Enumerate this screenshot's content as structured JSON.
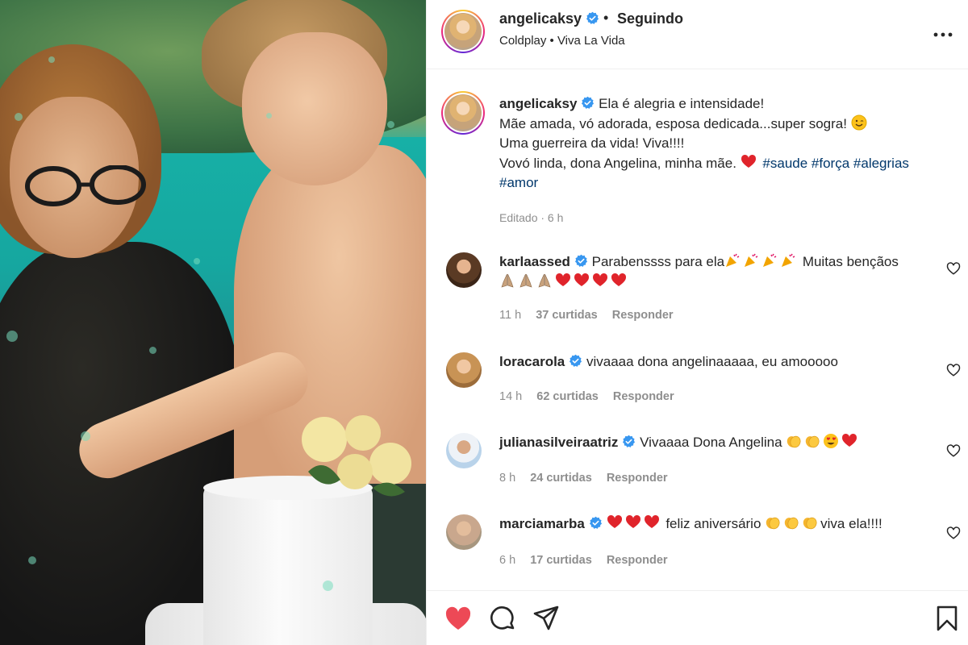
{
  "post": {
    "username": "angelicaksy",
    "following_label": "Seguindo",
    "separator": "•",
    "music": "Coldplay • Viva La Vida"
  },
  "caption": {
    "username": "angelicaksy",
    "line1": "Ela é alegria e intensidade!",
    "line2": "Mãe amada, vó adorada, esposa dedicada...super sogra!",
    "line3": "Uma guerreira da vida! Viva!!!!",
    "line4": "Vovó linda, dona Angelina, minha mãe.",
    "tags": [
      "#saude",
      "#força",
      "#alegrias",
      "#amor"
    ],
    "edited": "Editado · 6 h"
  },
  "comments": [
    {
      "username": "karlaassed",
      "text_a": "Parabenssss para ela",
      "text_b": "Muitas bençãos",
      "time": "11 h",
      "likes": "37 curtidas",
      "reply": "Responder"
    },
    {
      "username": "loracarola",
      "text": "vivaaaa dona angelinaaaaa, eu amooooo",
      "time": "14 h",
      "likes": "62 curtidas",
      "reply": "Responder"
    },
    {
      "username": "julianasilveiraatriz",
      "text": "Vivaaaa Dona Angelina",
      "time": "8 h",
      "likes": "24 curtidas",
      "reply": "Responder"
    },
    {
      "username": "marciamarba",
      "text_a": "feliz aniversário",
      "text_b": "viva ela!!!!",
      "time": "6 h",
      "likes": "17 curtidas",
      "reply": "Responder"
    }
  ],
  "colors": {
    "verified": "#3897f0",
    "heart": "#ed4956",
    "hashtag": "#00376b",
    "meta": "#8e8e8e"
  },
  "icons": [
    "verified-icon",
    "more-options-icon",
    "heart-icon",
    "comment-icon",
    "share-icon",
    "bookmark-icon"
  ]
}
